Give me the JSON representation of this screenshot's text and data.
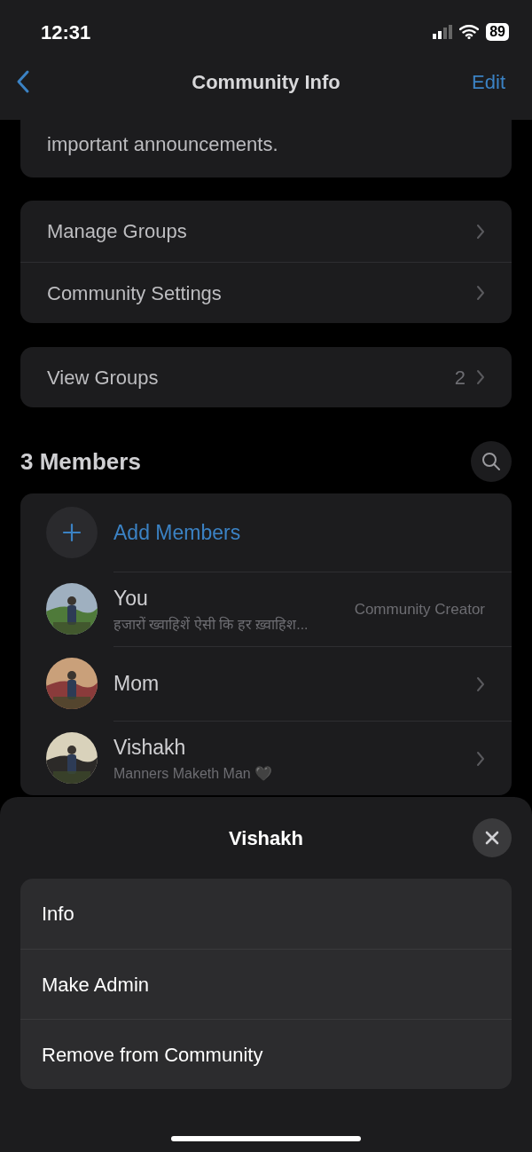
{
  "status_bar": {
    "time": "12:31",
    "battery": "89"
  },
  "nav": {
    "title": "Community Info",
    "action": "Edit"
  },
  "description": "important announcements.",
  "settings": [
    {
      "label": "Manage Groups"
    },
    {
      "label": "Community Settings"
    }
  ],
  "view_groups": {
    "label": "View Groups",
    "count": "2"
  },
  "members_header": "3 Members",
  "add_members": "Add Members",
  "members": [
    {
      "name": "You",
      "subtitle": "हजारों ख्वाहिशें ऐसी कि हर ख़्वाहिश...",
      "role": "Community Creator",
      "chevron": false
    },
    {
      "name": "Mom",
      "chevron": true
    },
    {
      "name": "Vishakh",
      "subtitle": "Manners Maketh Man 🖤",
      "chevron": true
    }
  ],
  "sheet": {
    "title": "Vishakh",
    "options": [
      "Info",
      "Make Admin",
      "Remove from Community"
    ]
  }
}
